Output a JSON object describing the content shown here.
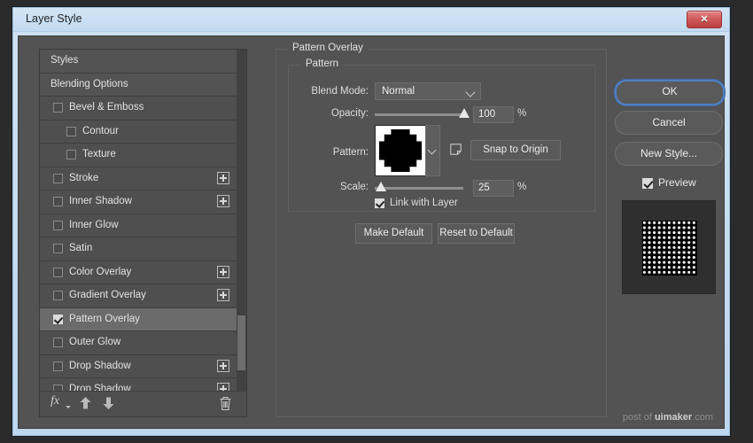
{
  "window": {
    "title": "Layer Style",
    "close_label": "✕"
  },
  "styles_panel": {
    "rows": [
      {
        "label": "Styles",
        "type": "header",
        "checkbox": null,
        "plus": false
      },
      {
        "label": "Blending Options",
        "type": "header",
        "checkbox": null,
        "plus": false
      },
      {
        "label": "Bevel & Emboss",
        "type": "normal",
        "checkbox": false,
        "plus": false
      },
      {
        "label": "Contour",
        "type": "sub",
        "checkbox": false,
        "plus": false
      },
      {
        "label": "Texture",
        "type": "sub",
        "checkbox": false,
        "plus": false
      },
      {
        "label": "Stroke",
        "type": "normal",
        "checkbox": false,
        "plus": true
      },
      {
        "label": "Inner Shadow",
        "type": "normal",
        "checkbox": false,
        "plus": true
      },
      {
        "label": "Inner Glow",
        "type": "normal",
        "checkbox": false,
        "plus": false
      },
      {
        "label": "Satin",
        "type": "normal",
        "checkbox": false,
        "plus": false
      },
      {
        "label": "Color Overlay",
        "type": "normal",
        "checkbox": false,
        "plus": true
      },
      {
        "label": "Gradient Overlay",
        "type": "normal",
        "checkbox": false,
        "plus": true
      },
      {
        "label": "Pattern Overlay",
        "type": "normal",
        "checkbox": true,
        "plus": false,
        "selected": true
      },
      {
        "label": "Outer Glow",
        "type": "normal",
        "checkbox": false,
        "plus": false
      },
      {
        "label": "Drop Shadow",
        "type": "normal",
        "checkbox": false,
        "plus": true
      },
      {
        "label": "Drop Shadow",
        "type": "normal",
        "checkbox": false,
        "plus": true
      }
    ],
    "toolbar": {
      "fx_label": "fx",
      "move_up_name": "move-up-arrow",
      "move_down_name": "move-down-arrow",
      "delete_name": "trash"
    }
  },
  "overlay": {
    "legend": "Pattern Overlay",
    "group_legend": "Pattern",
    "blend_mode": {
      "label": "Blend Mode:",
      "value": "Normal"
    },
    "opacity": {
      "label": "Opacity:",
      "value": "100",
      "unit": "%"
    },
    "pattern": {
      "label": "Pattern:",
      "snap_button": "Snap to Origin",
      "new_preset_icon": "new-preset-icon"
    },
    "scale": {
      "label": "Scale:",
      "value": "25",
      "unit": "%"
    },
    "link_with_layer": {
      "label": "Link with Layer",
      "checked": true
    },
    "buttons": {
      "make_default": "Make Default",
      "reset_to_default": "Reset to Default"
    }
  },
  "actions": {
    "ok": "OK",
    "cancel": "Cancel",
    "new_style": "New Style...",
    "preview": {
      "label": "Preview",
      "checked": true
    }
  },
  "watermark": {
    "prefix": "post of ",
    "brand": "uimaker",
    "suffix": ".com"
  },
  "colors": {
    "dialog_bg": "#535353",
    "panel_bg": "#4a4a4a",
    "row_bg": "#4f4f4f",
    "row_selected": "#6b6b6b",
    "control_bg": "#5e5e5e",
    "accent_focus": "#4f7fc0",
    "titlebar": "#cfe2f3",
    "close_red": "#cd5656",
    "text": "#e2e2e2"
  }
}
